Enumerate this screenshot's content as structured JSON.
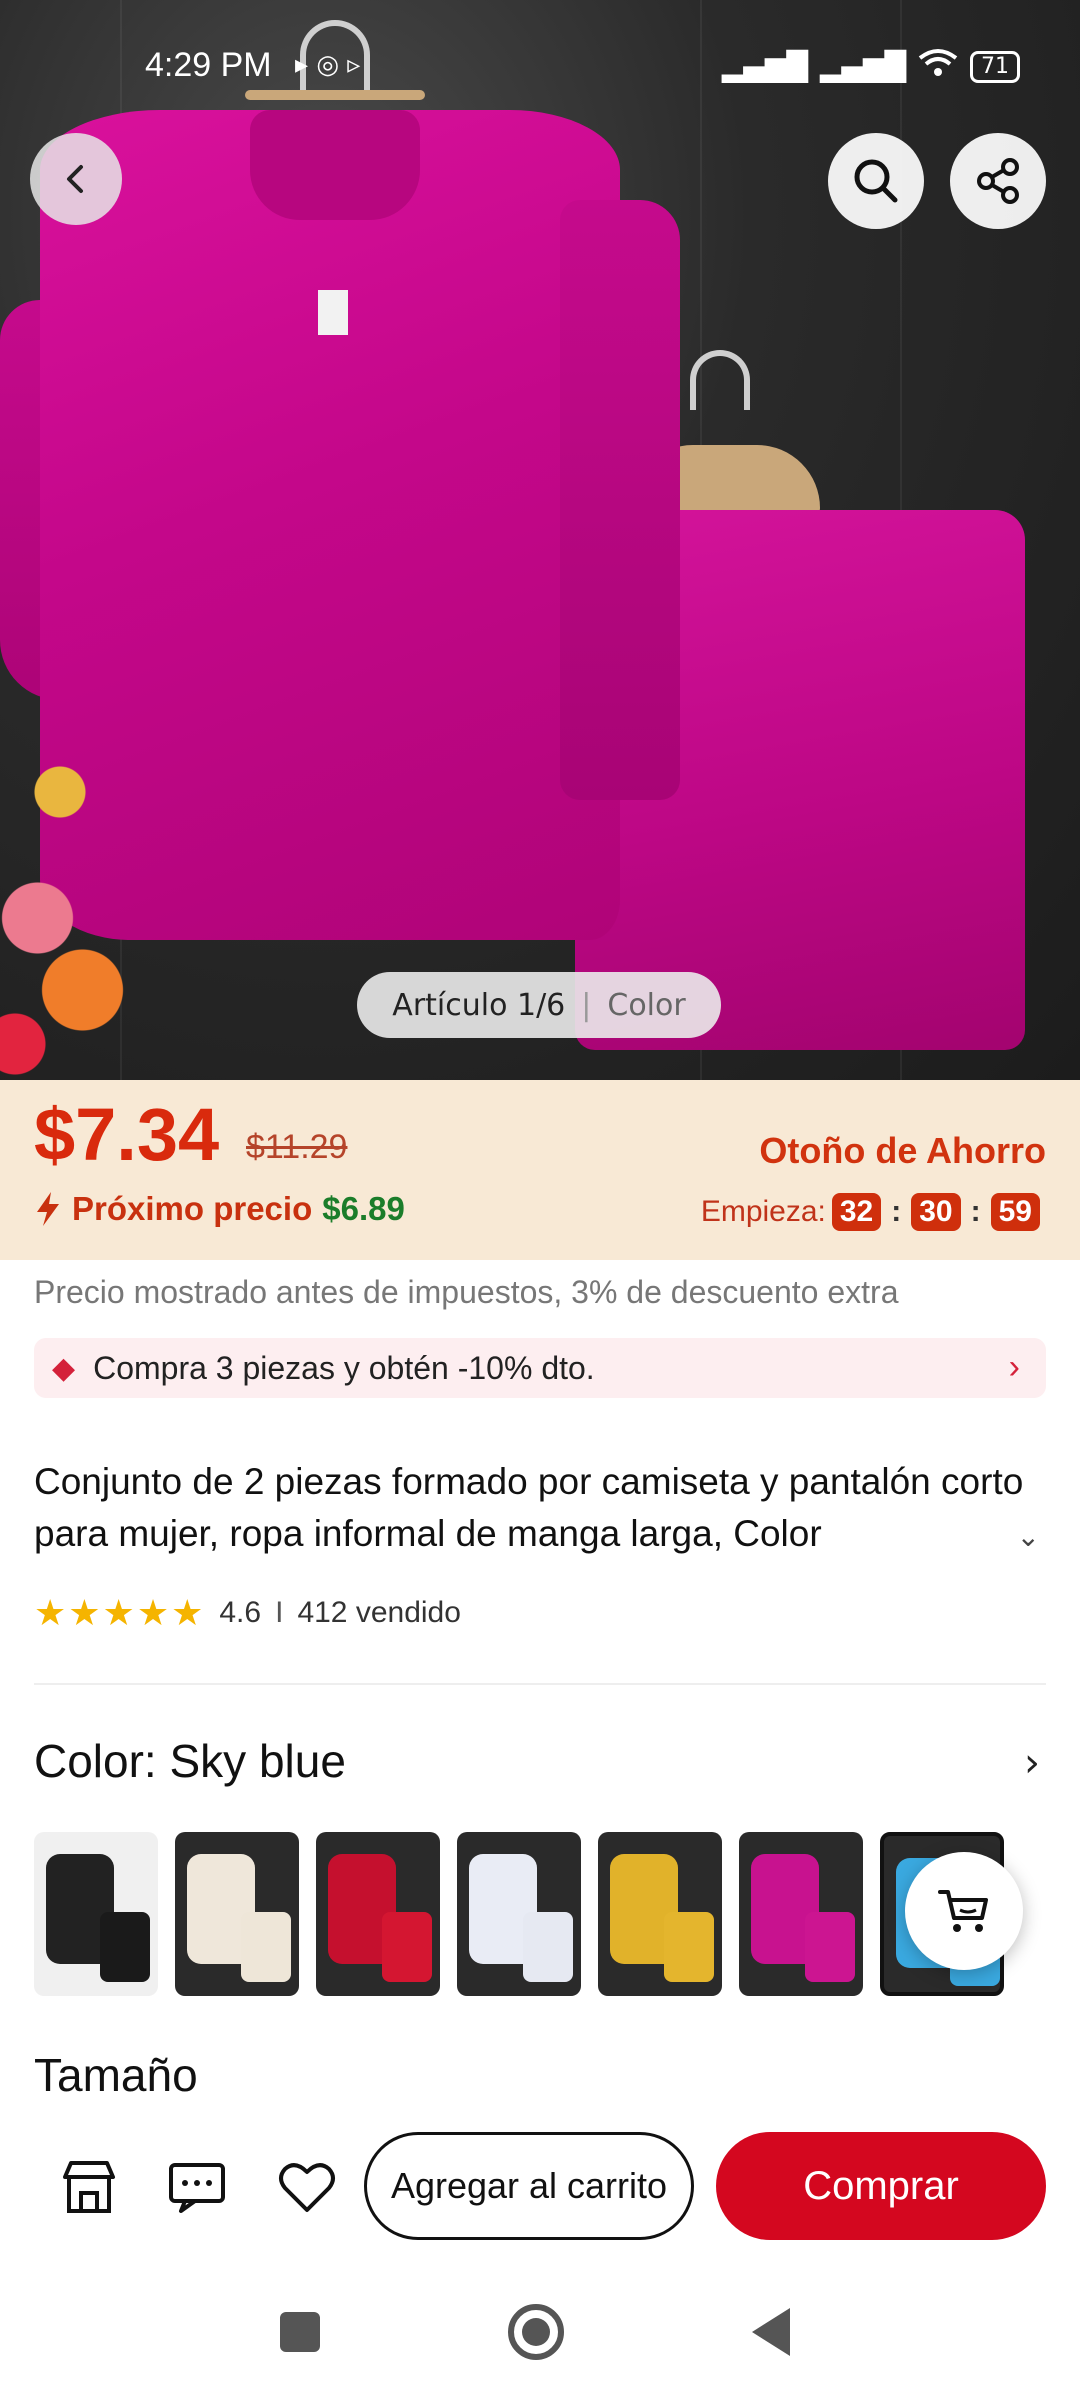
{
  "status_bar": {
    "time": "4:29 PM",
    "battery": "71"
  },
  "gallery": {
    "counter": "Artículo 1/6",
    "label": "Color"
  },
  "price": {
    "current": "$7.34",
    "original": "$11.29",
    "next_label": "Próximo precio",
    "next_value": "$6.89",
    "promo_name": "Otoño de Ahorro",
    "countdown_label": "Empieza:",
    "countdown": [
      "32",
      "30",
      "59"
    ]
  },
  "tax_note": "Precio mostrado antes de impuestos, 3% de descuento extra",
  "coupon": {
    "text": "Compra 3 piezas y obtén -10% dto."
  },
  "product": {
    "title": "Conjunto de 2 piezas formado por camiseta y pantalón corto para mujer, ropa informal de manga larga, Color",
    "rating": "4.6",
    "sold": "412 vendido"
  },
  "color": {
    "label": "Color: Sky blue",
    "swatches": [
      {
        "name": "black",
        "top": "#222222",
        "bottom": "#1a1a1a",
        "bg": "#f0f0f0"
      },
      {
        "name": "beige",
        "top": "#efe7da",
        "bottom": "#eee6d8",
        "bg": "#2a2a2a"
      },
      {
        "name": "red",
        "top": "#c5102e",
        "bottom": "#d41631",
        "bg": "#2a2a2a"
      },
      {
        "name": "white",
        "top": "#e9ecf5",
        "bottom": "#e6e9f2",
        "bg": "#2a2a2a"
      },
      {
        "name": "yellow",
        "top": "#e1b22a",
        "bottom": "#e4b52d",
        "bg": "#2a2a2a"
      },
      {
        "name": "rose-red",
        "top": "#c8128f",
        "bottom": "#cc1591",
        "bg": "#2a2a2a"
      },
      {
        "name": "sky-blue",
        "top": "#3aa9e0",
        "bottom": "#3aa9e0",
        "bg": "#2a2a2a"
      }
    ]
  },
  "size": {
    "label": "Tamaño"
  },
  "actions": {
    "add_to_cart": "Agregar al carrito",
    "buy": "Comprar"
  },
  "colors": {
    "accent": "#d4071f",
    "price": "#d92a0d",
    "banner": "#f8e9d5"
  }
}
